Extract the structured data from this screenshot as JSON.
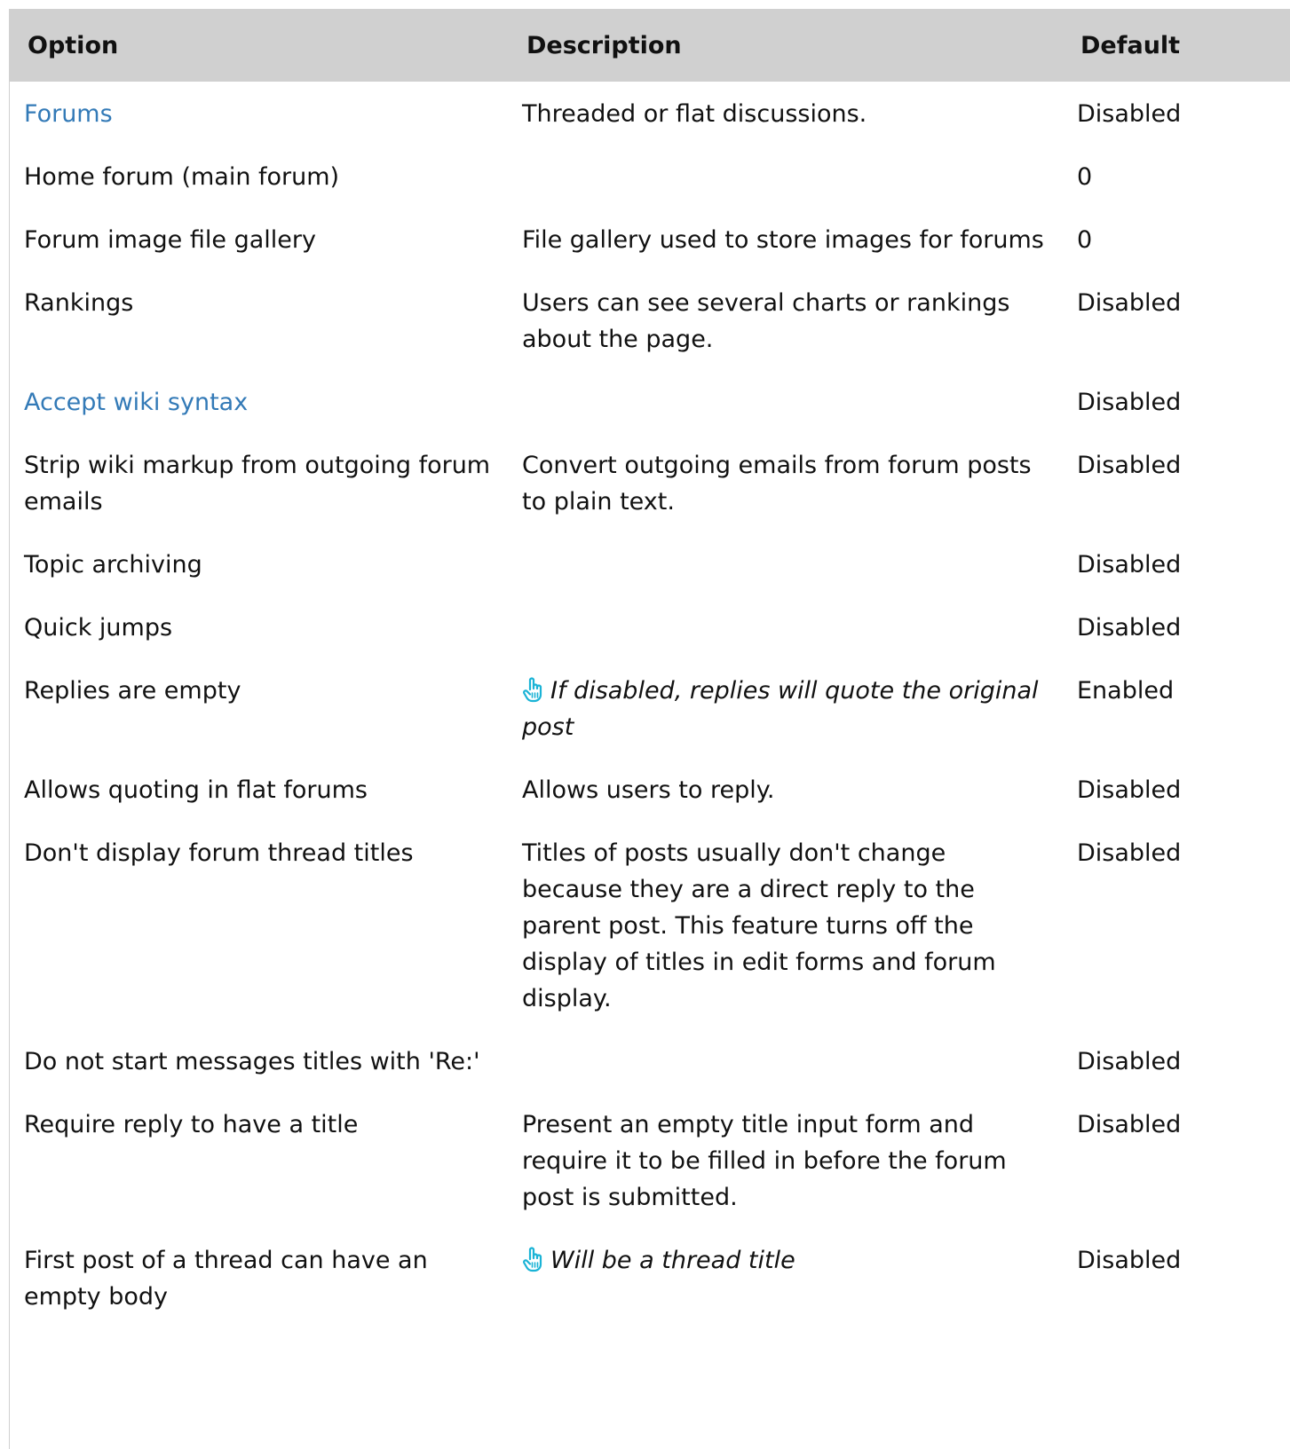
{
  "table": {
    "headers": {
      "option": "Option",
      "description": "Description",
      "default": "Default"
    },
    "rows": [
      {
        "option": "Forums",
        "option_link": true,
        "description": "Threaded or flat discussions.",
        "description_style": "plain",
        "default": "Disabled"
      },
      {
        "option": "Home forum (main forum)",
        "option_link": false,
        "description": "",
        "description_style": "plain",
        "default": "0"
      },
      {
        "option": "Forum image file gallery",
        "option_link": false,
        "description": "File gallery used to store images for forums",
        "description_style": "plain",
        "default": "0"
      },
      {
        "option": "Rankings",
        "option_link": false,
        "description": "Users can see several charts or rankings about the page.",
        "description_style": "plain",
        "default": "Disabled"
      },
      {
        "option": "Accept wiki syntax",
        "option_link": true,
        "description": "",
        "description_style": "plain",
        "default": "Disabled"
      },
      {
        "option": "Strip wiki markup from outgoing forum emails",
        "option_link": false,
        "description": "Convert outgoing emails from forum posts to plain text.",
        "description_style": "plain",
        "default": "Disabled"
      },
      {
        "option": "Topic archiving",
        "option_link": false,
        "description": "",
        "description_style": "plain",
        "default": "Disabled"
      },
      {
        "option": "Quick jumps",
        "option_link": false,
        "description": "",
        "description_style": "plain",
        "default": "Disabled"
      },
      {
        "option": "Replies are empty",
        "option_link": false,
        "description": "If disabled, replies will quote the original post",
        "description_style": "note",
        "default": "Enabled"
      },
      {
        "option": "Allows quoting in flat forums",
        "option_link": false,
        "description": "Allows users to reply.",
        "description_style": "plain",
        "default": "Disabled"
      },
      {
        "option": "Don't display forum thread titles",
        "option_link": false,
        "description": "Titles of posts usually don't change because they are a direct reply to the parent post. This feature turns off the display of titles in edit forms and forum display.",
        "description_style": "plain",
        "default": "Disabled"
      },
      {
        "option": "Do not start messages titles with 'Re:'",
        "option_link": false,
        "description": "",
        "description_style": "plain",
        "default": "Disabled"
      },
      {
        "option": "Require reply to have a title",
        "option_link": false,
        "description": "Present an empty title input form and require it to be filled in before the forum post is submitted.",
        "description_style": "plain",
        "default": "Disabled"
      },
      {
        "option": "First post of a thread can have an empty body",
        "option_link": false,
        "description": "Will be a thread title",
        "description_style": "note",
        "default": "Disabled"
      }
    ]
  },
  "colors": {
    "header_bg": "#d0d0d0",
    "link": "#337ab7",
    "note_icon": "#1ab3d6"
  },
  "icons": {
    "note": "pointing-hand-icon"
  }
}
